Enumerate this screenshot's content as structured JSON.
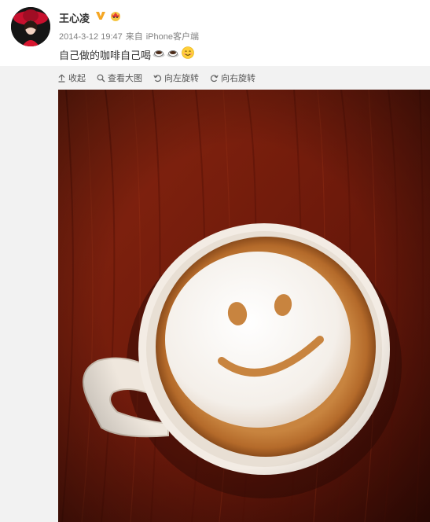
{
  "post": {
    "username": "王心凌",
    "timestamp": "2014-3-12 19:47",
    "source_prefix": "来自",
    "source": "iPhone客户端",
    "text": "自己做的咖啡自己喝"
  },
  "toolbar": {
    "collapse_label": "收起",
    "view_large_label": "查看大图",
    "rotate_left_label": "向左旋转",
    "rotate_right_label": "向右旋转"
  },
  "icons": {
    "collapse": "arrow-up-icon",
    "view_large": "magnifier-icon",
    "rotate_left": "rotate-left-icon",
    "rotate_right": "rotate-right-icon",
    "verified": "vip-v-icon",
    "member": "crown-member-icon",
    "emojis": [
      "coffee-emoji",
      "coffee-emoji",
      "smile-emoji"
    ]
  },
  "colors": {
    "username": "#333333",
    "meta": "#808080",
    "vip_badge": "#f5a623",
    "panel_bg": "#f2f2f2",
    "photo_wood": "#7a1e0f"
  }
}
